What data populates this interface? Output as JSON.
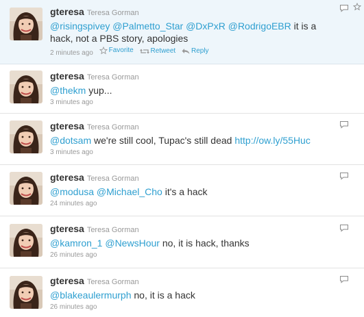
{
  "tweets": [
    {
      "handle": "gteresa",
      "fullname": "Teresa Gorman",
      "mentions": [
        "@risingspivey",
        "@Palmetto_Star",
        "@DxPxR",
        "@RodrigoEBR"
      ],
      "text_line1_rest": " it is a",
      "text_line2": "hack, not a PBS story, apologies",
      "time": "2 minutes ago",
      "actions": {
        "favorite": "Favorite",
        "retweet": "Retweet",
        "reply": "Reply"
      }
    },
    {
      "handle": "gteresa",
      "fullname": "Teresa Gorman",
      "mention": "@thekm",
      "rest": " yup...",
      "time": "3 minutes ago"
    },
    {
      "handle": "gteresa",
      "fullname": "Teresa Gorman",
      "mention": "@dotsam",
      "rest": " we're still cool, Tupac's still dead ",
      "link": "http://ow.ly/55Huc",
      "time": "3 minutes ago"
    },
    {
      "handle": "gteresa",
      "fullname": "Teresa Gorman",
      "mention1": "@modusa",
      "mention2": "@Michael_Cho",
      "rest": " it's a hack",
      "time": "24 minutes ago"
    },
    {
      "handle": "gteresa",
      "fullname": "Teresa Gorman",
      "mention1": "@kamron_1",
      "mention2": "@NewsHour",
      "rest": " no, it is hack, thanks",
      "time": "26 minutes ago"
    },
    {
      "handle": "gteresa",
      "fullname": "Teresa Gorman",
      "mention": "@blakeaulermurph",
      "rest": " no, it is a hack",
      "time": "26 minutes ago"
    }
  ],
  "colors": {
    "link": "#2e9fd0",
    "highlight_bg": "#eef6fb",
    "muted": "#999999",
    "text": "#333333"
  }
}
